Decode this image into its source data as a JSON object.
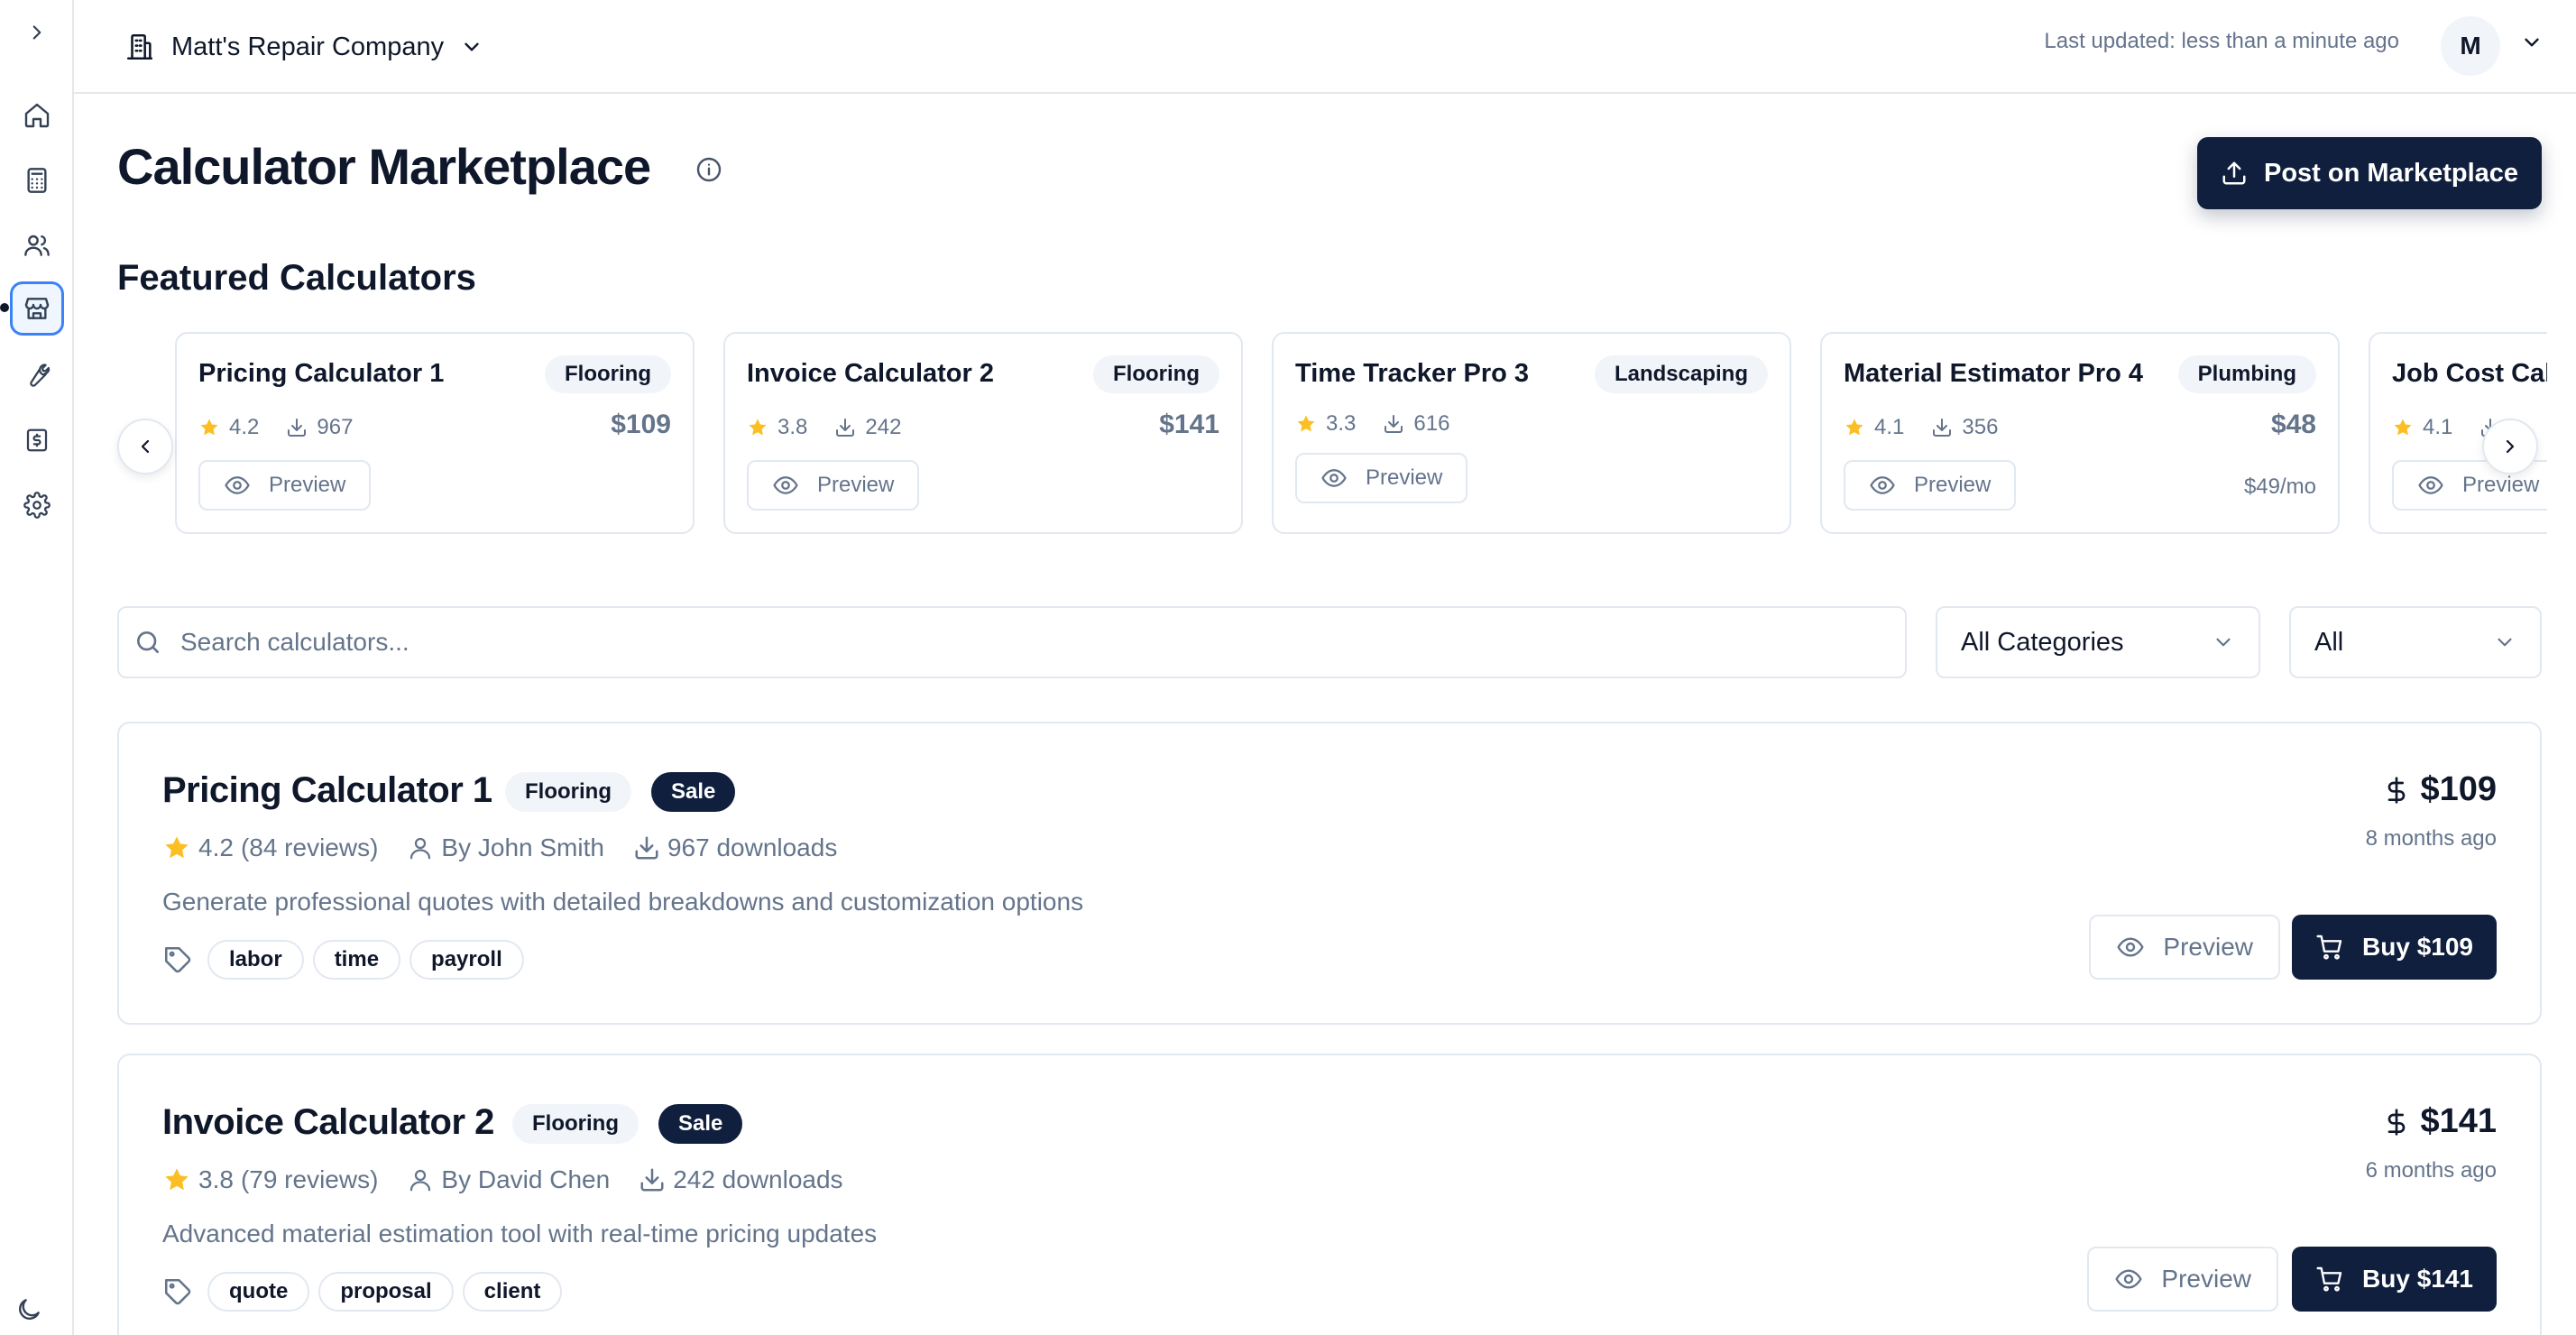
{
  "sidebar": {
    "items": [
      {
        "name": "expand",
        "icon": "chevron-right-icon"
      },
      {
        "name": "home",
        "icon": "home-icon"
      },
      {
        "name": "calculators",
        "icon": "calculator-icon"
      },
      {
        "name": "customers",
        "icon": "users-icon"
      },
      {
        "name": "marketplace",
        "icon": "store-icon",
        "active": true
      },
      {
        "name": "tools",
        "icon": "wrench-icon"
      },
      {
        "name": "billing",
        "icon": "receipt-dollar-icon"
      },
      {
        "name": "settings",
        "icon": "gear-icon"
      }
    ],
    "theme_icon": "moon-icon"
  },
  "header": {
    "company": "Matt's Repair Company",
    "last_updated": "Last updated: less than a minute ago",
    "avatar_initial": "M"
  },
  "page": {
    "title": "Calculator Marketplace",
    "post_button": "Post on Marketplace",
    "featured_title": "Featured Calculators"
  },
  "featured": [
    {
      "name": "Pricing Calculator 1",
      "category": "Flooring",
      "rating": "4.2",
      "downloads": "967",
      "price": "$109",
      "sub": "",
      "preview": "Preview"
    },
    {
      "name": "Invoice Calculator 2",
      "category": "Flooring",
      "rating": "3.8",
      "downloads": "242",
      "price": "$141",
      "sub": "",
      "preview": "Preview"
    },
    {
      "name": "Time Tracker Pro 3",
      "category": "Landscaping",
      "rating": "3.3",
      "downloads": "616",
      "price": "",
      "sub": "",
      "preview": "Preview"
    },
    {
      "name": "Material Estimator Pro 4",
      "category": "Plumbing",
      "rating": "4.1",
      "downloads": "356",
      "price": "$48",
      "sub": "$49/mo",
      "preview": "Preview"
    },
    {
      "name": "Job Cost Cal",
      "category": "",
      "rating": "4.1",
      "downloads": "",
      "price": "",
      "sub": "",
      "preview": "Preview"
    }
  ],
  "filters": {
    "search_placeholder": "Search calculators...",
    "category": "All Categories",
    "type": "All"
  },
  "listings": [
    {
      "name": "Pricing Calculator 1",
      "category": "Flooring",
      "badge": "Sale",
      "rating": "4.2",
      "reviews": "(84 reviews)",
      "author": "By John Smith",
      "downloads": "967 downloads",
      "description": "Generate professional quotes with detailed breakdowns and customization options",
      "tags": [
        "labor",
        "time",
        "payroll"
      ],
      "price": "$109",
      "ago": "8 months ago",
      "preview": "Preview",
      "buy": "Buy $109"
    },
    {
      "name": "Invoice Calculator 2",
      "category": "Flooring",
      "badge": "Sale",
      "rating": "3.8",
      "reviews": "(79 reviews)",
      "author": "By David Chen",
      "downloads": "242 downloads",
      "description": "Advanced material estimation tool with real-time pricing updates",
      "tags": [
        "quote",
        "proposal",
        "client"
      ],
      "price": "$141",
      "ago": "6 months ago",
      "preview": "Preview",
      "buy": "Buy $141"
    }
  ],
  "colors": {
    "primary": "#0f1f3d",
    "star": "#fbbf24",
    "muted": "#64748b",
    "border": "#e2e8f0",
    "active_ring": "#3b82f6"
  }
}
